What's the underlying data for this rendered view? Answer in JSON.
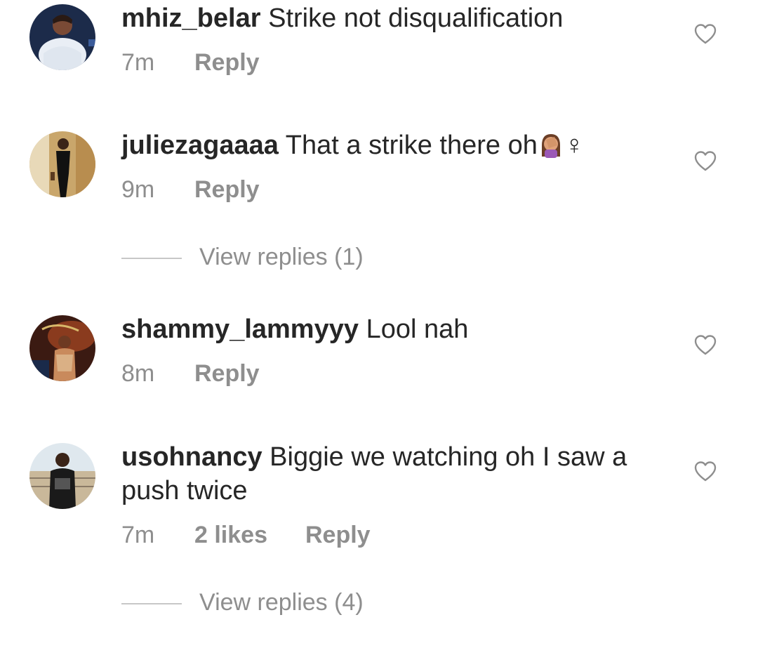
{
  "comments": [
    {
      "username": "mhiz_belar",
      "text": "Strike not disqualification",
      "time": "7m",
      "reply_label": "Reply",
      "avatar_icon": "avatar-photo-woman-white-dress",
      "like_icon": "heart-outline-icon"
    },
    {
      "username": "juliezagaaaa",
      "text": "That a strike there oh",
      "emoji": "woman-facepalming-emoji",
      "trailing_symbol": "♀",
      "time": "9m",
      "reply_label": "Reply",
      "view_replies": "View replies (1)",
      "avatar_icon": "avatar-photo-woman-black-outfit",
      "like_icon": "heart-outline-icon"
    },
    {
      "username": "shammy_lammyyy",
      "text": "Lool nah",
      "time": "8m",
      "reply_label": "Reply",
      "avatar_icon": "avatar-photo-woman-red-background",
      "like_icon": "heart-outline-icon"
    },
    {
      "username": "usohnancy",
      "text": "Biggie we watching oh I saw a push twice",
      "time": "7m",
      "likes": "2 likes",
      "reply_label": "Reply",
      "view_replies": "View replies (4)",
      "avatar_icon": "avatar-photo-woman-beach",
      "like_icon": "heart-outline-icon"
    }
  ],
  "colors": {
    "text_primary": "#262626",
    "text_secondary": "#8e8e8e",
    "divider": "#c7c7c7",
    "background": "#ffffff"
  }
}
